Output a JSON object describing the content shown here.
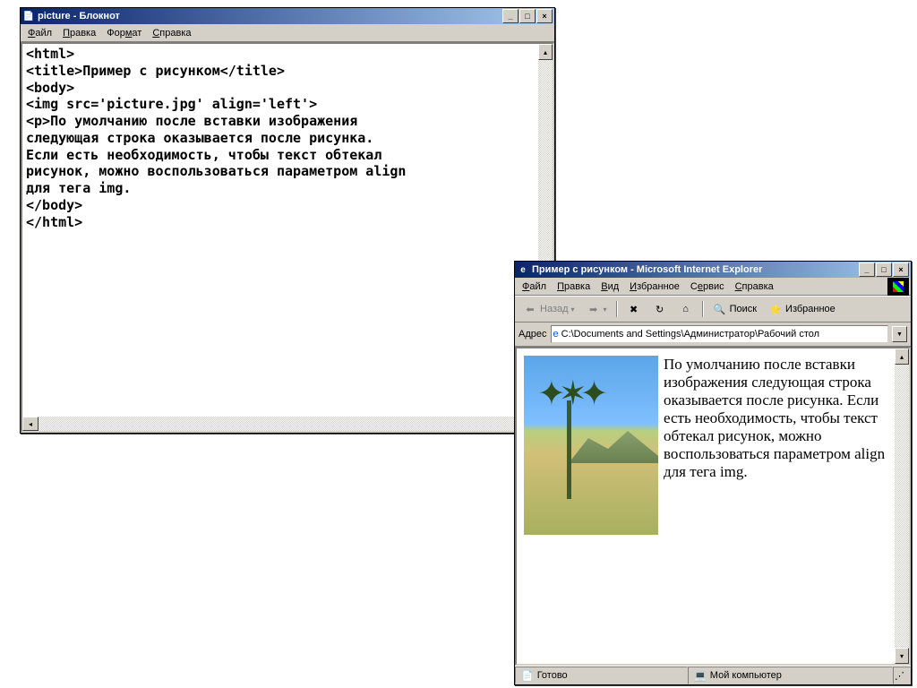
{
  "notepad": {
    "title": "picture - Блокнот",
    "menus": [
      "Файл",
      "Правка",
      "Формат",
      "Справка"
    ],
    "content": "<html>\n<title>Пример с рисунком</title>\n<body>\n<img src='picture.jpg' align='left'>\n<p>По умолчанию после вставки изображения\nследующая строка оказывается после рисунка.\nЕсли есть необходимость, чтобы текст обтекал\nрисунок, можно воспользоваться параметром align\nдля тега img.\n</body>\n</html>"
  },
  "ie": {
    "title": "Пример с рисунком - Microsoft Internet Explorer",
    "menus": [
      "Файл",
      "Правка",
      "Вид",
      "Избранное",
      "Сервис",
      "Справка"
    ],
    "toolbar": {
      "back": "Назад",
      "search": "Поиск",
      "favorites": "Избранное"
    },
    "address": {
      "label": "Адрес",
      "value": "C:\\Documents and Settings\\Администратор\\Рабочий стол"
    },
    "page_text": "По умолчанию после вставки изображения следующая строка оказывается после рисунка. Если есть необходимость, чтобы текст обтекал рисунок, можно воспользоваться параметром align для тега img.",
    "status": {
      "left": "Готово",
      "right": "Мой компьютер"
    }
  }
}
